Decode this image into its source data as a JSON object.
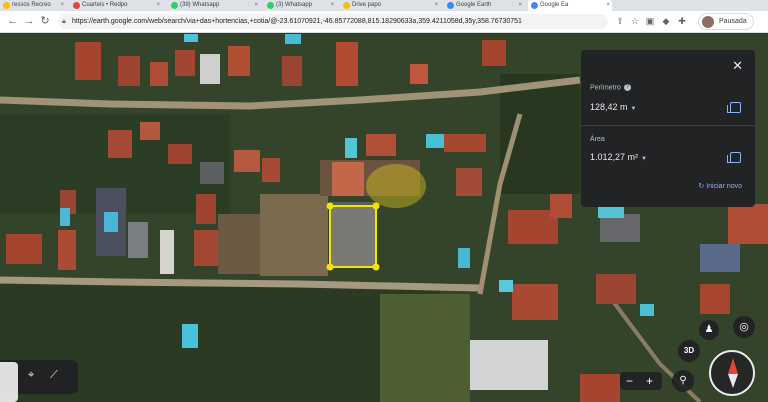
{
  "browser": {
    "tabs": [
      {
        "label": "ressos Recreo",
        "favicon_color": "#fbbc04"
      },
      {
        "label": "Cuarteis • Redpo",
        "favicon_color": "#ea4335"
      },
      {
        "label": "(39) Whatsapp",
        "favicon_color": "#25d366"
      },
      {
        "label": "(3) Whatsapp",
        "favicon_color": "#25d366"
      },
      {
        "label": "Drive papo",
        "favicon_color": "#fbbc04"
      },
      {
        "label": "Google Earth",
        "favicon_color": "#4285f4"
      },
      {
        "label": "Google Ea",
        "favicon_color": "#4285f4"
      }
    ],
    "url": "https://earth.google.com/web/search/via+das+hortencias,+cotia/@-23.61070921,-46.85772088,815.18290633a,359.4211058d,35y,358.76730751",
    "profile_name": "Pausada",
    "icons": {
      "back": "arrow-left-icon",
      "forward": "arrow-right-icon",
      "reload": "reload-icon",
      "lock": "lock-icon",
      "share": "share-icon",
      "star": "star-icon",
      "extensions": "puzzle-icon"
    }
  },
  "measure_panel": {
    "perimeter_label": "Perímetro",
    "perimeter_value": "128,42 m",
    "area_label": "Área",
    "area_value": "1.012,27 m²",
    "restart_label": "Iniciar novo",
    "close_icon": "close-icon",
    "copy_icon": "copy-icon",
    "restart_icon": "restart-icon",
    "info_icon": "info-icon"
  },
  "map_controls": {
    "view_3d_label": "3D",
    "zoom_in": "+",
    "zoom_out": "−",
    "icons": [
      "street-view-icon",
      "locate-icon",
      "compass-icon",
      "location-pin-icon",
      "measure-icon"
    ]
  },
  "colors": {
    "polygon_stroke": "#f4e500",
    "panel_bg": "#202124",
    "accent": "#8ab4f8"
  }
}
